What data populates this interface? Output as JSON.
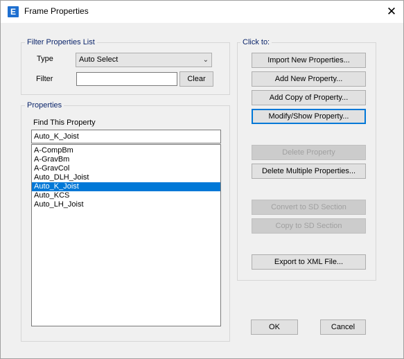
{
  "window": {
    "title": "Frame Properties",
    "app_icon_letter": "E",
    "close_glyph": "✕"
  },
  "filter_group": {
    "title": "Filter Properties List",
    "type_label": "Type",
    "type_value": "Auto Select",
    "filter_label": "Filter",
    "filter_value": "",
    "clear_label": "Clear"
  },
  "properties_group": {
    "title": "Properties",
    "find_label": "Find This Property",
    "find_value": "Auto_K_Joist",
    "items": [
      "A-CompBm",
      "A-GravBm",
      "A-GravCol",
      "Auto_DLH_Joist",
      "Auto_K_Joist",
      "Auto_KCS",
      "Auto_LH_Joist"
    ],
    "selected_index": 4
  },
  "click_group": {
    "title": "Click to:",
    "import_label": "Import New Properties...",
    "add_new_label": "Add New Property...",
    "add_copy_label": "Add Copy of Property...",
    "modify_label": "Modify/Show Property...",
    "delete_label": "Delete Property",
    "delete_multiple_label": "Delete Multiple Properties...",
    "convert_sd_label": "Convert to SD Section",
    "copy_sd_label": "Copy to SD Section",
    "export_xml_label": "Export to XML File..."
  },
  "footer": {
    "ok_label": "OK",
    "cancel_label": "Cancel"
  }
}
